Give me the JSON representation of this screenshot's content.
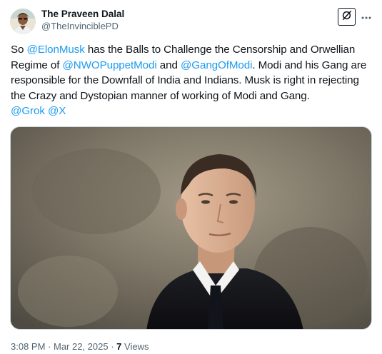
{
  "author": {
    "display_name": "The Praveen Dalal",
    "handle": "@TheInvinciblePD"
  },
  "tweet": {
    "segments": [
      {
        "text": "So ",
        "type": "text"
      },
      {
        "text": "@ElonMusk",
        "type": "mention"
      },
      {
        "text": " has the Balls to Challenge the Censorship and Orwellian Regime of ",
        "type": "text"
      },
      {
        "text": "@NWOPuppetModi",
        "type": "mention"
      },
      {
        "text": " and ",
        "type": "text"
      },
      {
        "text": "@GangOfModi",
        "type": "mention"
      },
      {
        "text": ". Modi and his Gang are responsible for the Downfall of India and Indians. Musk is right in rejecting the Crazy and Dystopian manner of working of Modi and Gang.",
        "type": "text"
      },
      {
        "text": "\n",
        "type": "break"
      },
      {
        "text": "@Grok",
        "type": "mention"
      },
      {
        "text": " ",
        "type": "text"
      },
      {
        "text": "@X",
        "type": "mention"
      }
    ]
  },
  "meta": {
    "time": "3:08 PM",
    "separator": " · ",
    "date": "Mar 22, 2025",
    "views_count": "7",
    "views_label": "Views"
  },
  "icons": {
    "grok": "grok-icon",
    "more": "more-horizontal-icon"
  },
  "colors": {
    "link": "#1d9bf0",
    "text": "#0f1419",
    "secondary": "#536471",
    "border": "#cfd9de"
  }
}
